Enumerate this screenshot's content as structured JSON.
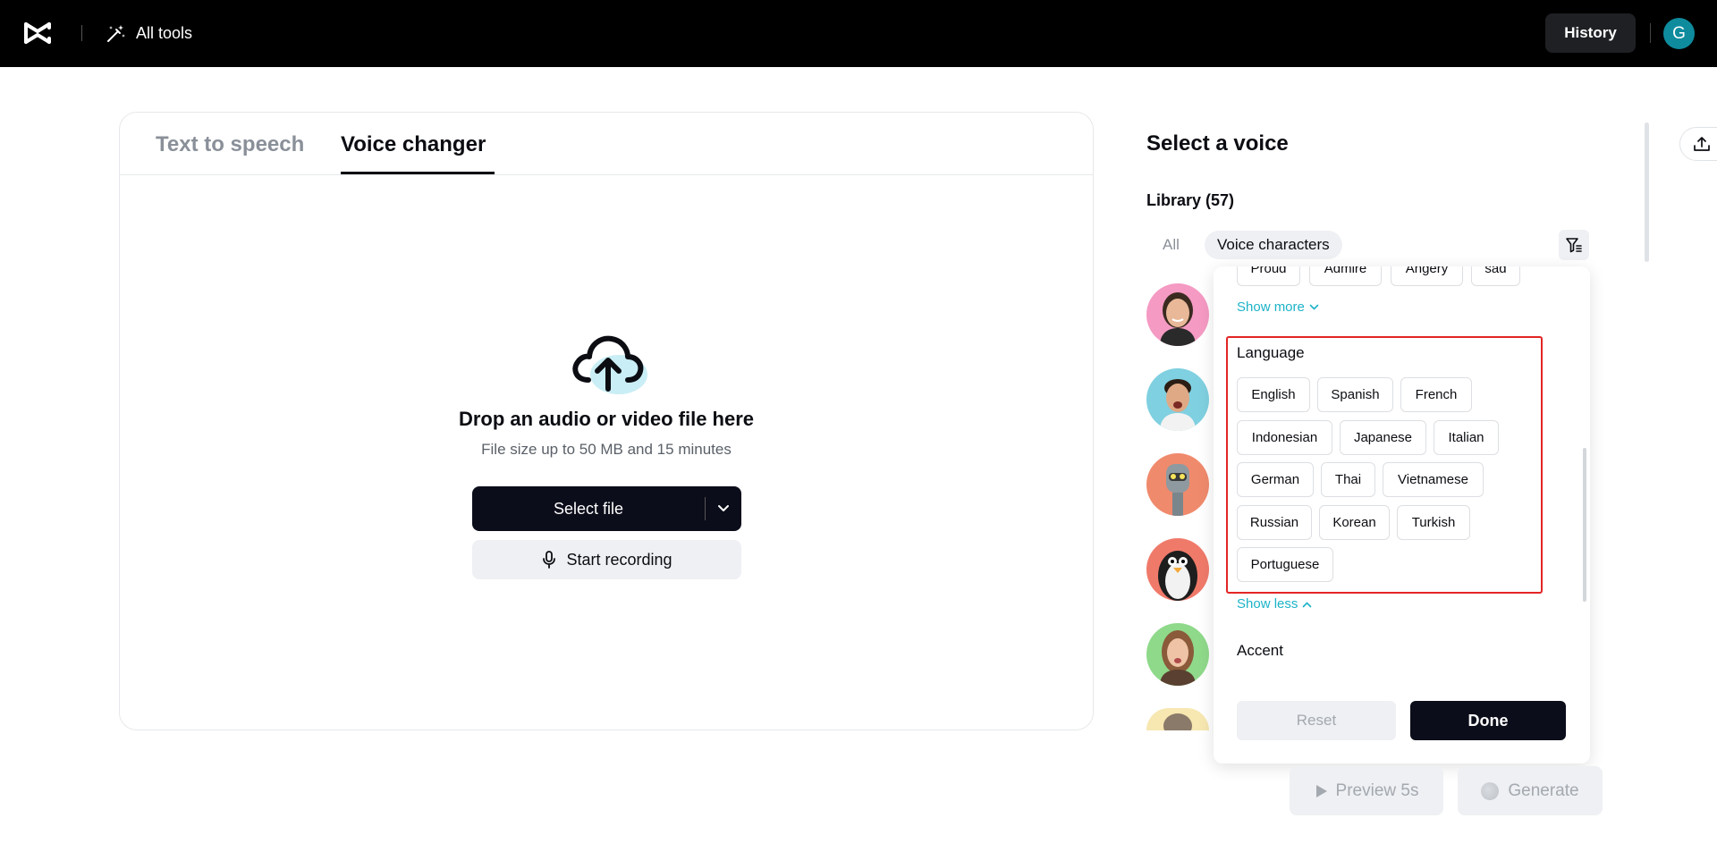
{
  "topbar": {
    "all_tools_label": "All tools",
    "history_label": "History",
    "user_initial": "G"
  },
  "tabs": [
    {
      "label": "Text to speech",
      "active": false
    },
    {
      "label": "Voice changer",
      "active": true
    }
  ],
  "upload": {
    "title": "Drop an audio or video file here",
    "subtitle": "File size up to 50 MB and 15 minutes",
    "select_file_label": "Select file",
    "start_recording_label": "Start recording"
  },
  "voice_panel": {
    "title": "Select a voice",
    "library_label": "Library (57)",
    "chip_all": "All",
    "chip_voice_characters": "Voice characters"
  },
  "filter_popup": {
    "emotion_tags": [
      "Proud",
      "Admire",
      "Angery",
      "sad"
    ],
    "show_more_label": "Show more",
    "language_title": "Language",
    "languages": [
      "English",
      "Spanish",
      "French",
      "Indonesian",
      "Japanese",
      "Italian",
      "German",
      "Thai",
      "Vietnamese",
      "Russian",
      "Korean",
      "Turkish",
      "Portuguese"
    ],
    "show_less_label": "Show less",
    "accent_title": "Accent",
    "reset_label": "Reset",
    "done_label": "Done"
  },
  "actions": {
    "preview_label": "Preview 5s",
    "generate_label": "Generate"
  },
  "colors": {
    "accent_link": "#1cb3c8",
    "highlight": "#e32525",
    "primary_dark": "#0b0d1a"
  }
}
